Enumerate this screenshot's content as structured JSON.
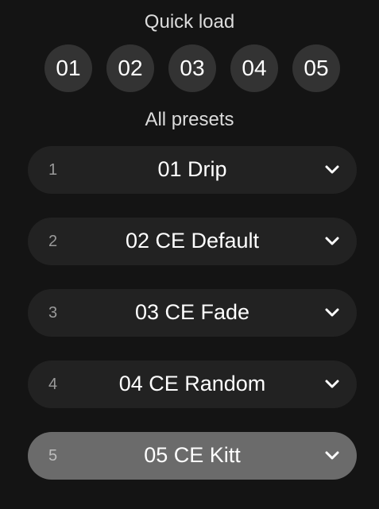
{
  "quick_load": {
    "title": "Quick load",
    "buttons": [
      "01",
      "02",
      "03",
      "04",
      "05"
    ]
  },
  "presets": {
    "title": "All presets",
    "items": [
      {
        "index": "1",
        "name": "01 Drip"
      },
      {
        "index": "2",
        "name": "02 CE Default"
      },
      {
        "index": "3",
        "name": "03 CE Fade"
      },
      {
        "index": "4",
        "name": "04 CE Random"
      },
      {
        "index": "5",
        "name": "05 CE Kitt"
      }
    ],
    "selected_index": 5
  },
  "colors": {
    "background": "#141414",
    "quick_button": "#333333",
    "preset_row": "#222222",
    "preset_row_active": "#6b6b6b"
  },
  "icons": {
    "dropdown": "chevron-down-icon"
  }
}
